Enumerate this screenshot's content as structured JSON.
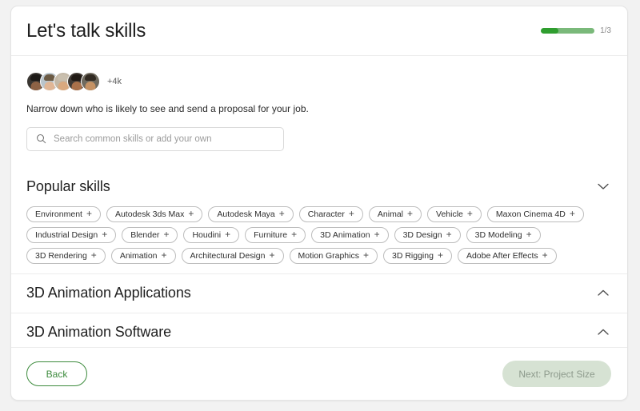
{
  "header": {
    "title": "Let's talk skills",
    "progress_label": "1/3",
    "progress_percent": 33,
    "progress_fill_color": "#2f9e2f",
    "progress_track_color": "#7ab97a"
  },
  "intro": {
    "avatar_overflow": "+4k",
    "avatar_count": 5,
    "description": "Narrow down who is likely to see and send a proposal for your job."
  },
  "search": {
    "icon": "search-icon",
    "value": "",
    "placeholder": "Search common skills or add your own"
  },
  "sections": [
    {
      "title": "Popular skills",
      "expanded": true,
      "chevron": "chevron-down-icon",
      "chips": [
        "Environment",
        "Autodesk 3ds Max",
        "Autodesk Maya",
        "Character",
        "Animal",
        "Vehicle",
        "Maxon Cinema 4D",
        "Industrial Design",
        "Blender",
        "Houdini",
        "Furniture",
        "3D Animation",
        "3D Design",
        "3D Modeling",
        "3D Rendering",
        "Animation",
        "Architectural Design",
        "Motion Graphics",
        "3D Rigging",
        "Adobe After Effects"
      ]
    },
    {
      "title": "3D Animation Applications",
      "expanded": false,
      "chevron": "chevron-up-icon",
      "chips": []
    },
    {
      "title": "3D Animation Software",
      "expanded": false,
      "chevron": "chevron-up-icon",
      "chips": []
    }
  ],
  "chip_add_glyph": "+",
  "footer": {
    "back_label": "Back",
    "next_label": "Next: Project Size",
    "next_disabled": true,
    "accent_color": "#3d8b3d",
    "next_bg_color": "#d6e2d3"
  }
}
